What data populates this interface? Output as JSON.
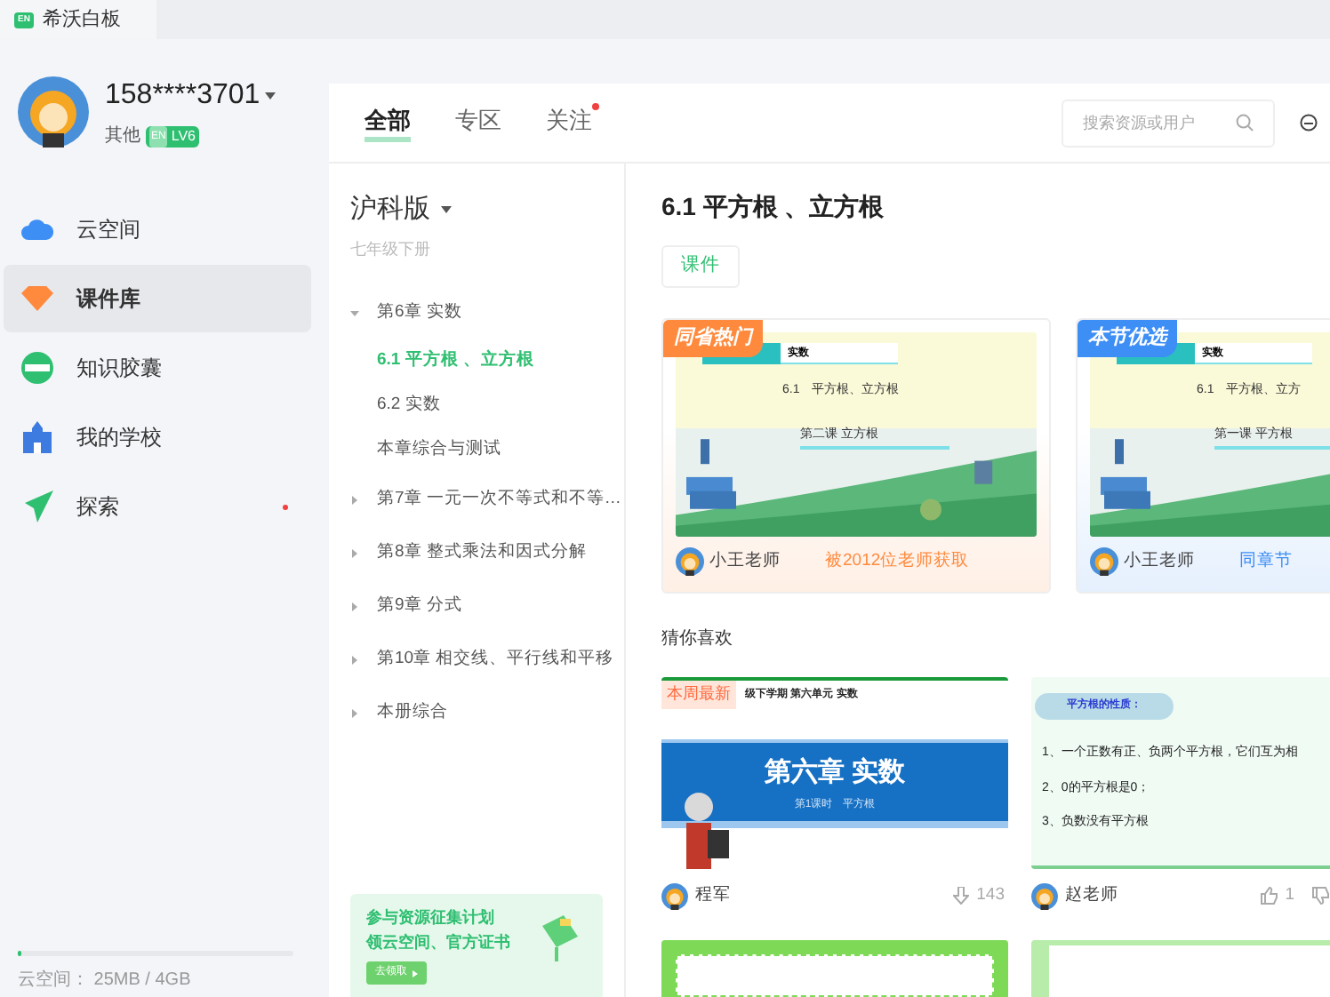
{
  "app_tab": {
    "logo": "EN",
    "title": "希沃白板"
  },
  "user": {
    "name": "158****3701",
    "role": "其他",
    "level_logo": "EN",
    "level": "LV6"
  },
  "nav": [
    {
      "label": "云空间",
      "selected": false,
      "dot": false
    },
    {
      "label": "课件库",
      "selected": true,
      "dot": false
    },
    {
      "label": "知识胶囊",
      "selected": false,
      "dot": false
    },
    {
      "label": "我的学校",
      "selected": false,
      "dot": false
    },
    {
      "label": "探索",
      "selected": false,
      "dot": true
    }
  ],
  "storage": {
    "text": "云空间： 25MB / 4GB",
    "level": 0.01
  },
  "tabs": [
    {
      "label": "全部",
      "selected": true,
      "dot": false
    },
    {
      "label": "专区",
      "selected": false,
      "dot": false
    },
    {
      "label": "关注",
      "selected": false,
      "dot": true
    }
  ],
  "search": {
    "placeholder": "搜索资源或用户"
  },
  "textbook": {
    "edition": "沪科版",
    "grade": "七年级下册",
    "chapters": [
      {
        "label": "第6章 实数",
        "expanded": true,
        "children": [
          {
            "label": "6.1 平方根 、立方根",
            "selected": true
          },
          {
            "label": "6.2 实数",
            "selected": false
          },
          {
            "label": "本章综合与测试",
            "selected": false
          }
        ]
      },
      {
        "label": "第7章 一元一次不等式和不等…",
        "expanded": false
      },
      {
        "label": "第8章 整式乘法和因式分解",
        "expanded": false
      },
      {
        "label": "第9章 分式",
        "expanded": false
      },
      {
        "label": "第10章 相交线、平行线和平移",
        "expanded": false
      },
      {
        "label": "本册综合",
        "expanded": false
      }
    ]
  },
  "promo": {
    "line1": "参与资源征集计划",
    "line2": "领云空间、官方证书",
    "button": "去领取"
  },
  "section": {
    "title": "6.1 平方根 、立方根",
    "filters": [
      {
        "label": "课件",
        "selected": true
      }
    ]
  },
  "featured": [
    {
      "badge": "同省热门",
      "color": "#ff8a3d",
      "chapter": "实数",
      "lesson": "6.1　平方根、立方根",
      "part": "第二课 立方根",
      "author": "小王老师",
      "note": "被2012位老师获取"
    },
    {
      "badge": "本节优选",
      "color": "#3d8ef5",
      "chapter": "实数",
      "lesson": "6.1　平方根、立方",
      "part": "第一课 平方根",
      "author": "小王老师",
      "note": "同章节"
    }
  ],
  "recommend": {
    "title": "猜你喜欢",
    "cards": [
      {
        "kind": "title-slide",
        "badge": "本周最新",
        "top": "级下学期 第六单元 实数",
        "heading": "第六章 实数",
        "sub": "第1课时　平方根",
        "author": "程军",
        "stat": {
          "kind": "downloads",
          "value": "143"
        }
      },
      {
        "kind": "list-slide",
        "bubble": "平方根的性质：",
        "lines": [
          "1、一个正数有正、负两个平方根，它们互为相",
          "2、0的平方根是0；",
          "3、负数没有平方根"
        ],
        "author": "赵老师",
        "stat": {
          "kind": "likes",
          "value": "1"
        }
      },
      {
        "kind": "green-frame"
      },
      {
        "kind": "green-stripes"
      }
    ]
  }
}
